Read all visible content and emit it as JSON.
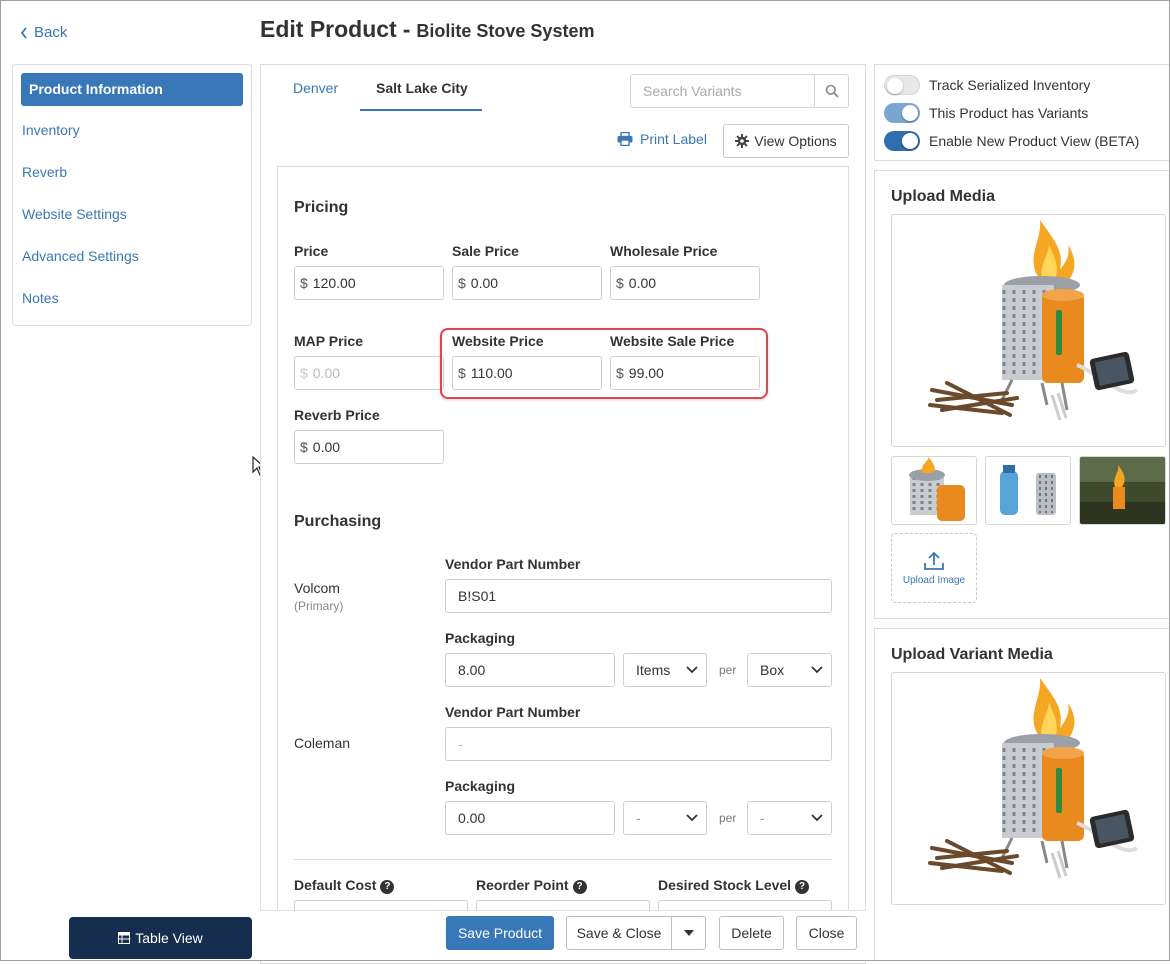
{
  "header": {
    "back_label": "Back",
    "title": "Edit Product",
    "separator": "-",
    "product_name": "Biolite Stove System"
  },
  "sidebar": {
    "items": [
      {
        "label": "Product Information",
        "active": true
      },
      {
        "label": "Inventory"
      },
      {
        "label": "Reverb"
      },
      {
        "label": "Website Settings"
      },
      {
        "label": "Advanced Settings"
      },
      {
        "label": "Notes"
      }
    ],
    "table_view_label": "Table View"
  },
  "tabs": [
    {
      "label": "Denver",
      "active": false
    },
    {
      "label": "Salt Lake City",
      "active": true
    }
  ],
  "search": {
    "placeholder": "Search Variants",
    "value": ""
  },
  "toolbar": {
    "print_label": "Print Label",
    "view_options": "View Options"
  },
  "pricing": {
    "title": "Pricing",
    "currency": "$",
    "price": {
      "label": "Price",
      "value": "120.00"
    },
    "sale_price": {
      "label": "Sale Price",
      "value": "0.00"
    },
    "wholesale_price": {
      "label": "Wholesale Price",
      "value": "0.00"
    },
    "map_price": {
      "label": "MAP Price",
      "value": "0.00"
    },
    "website_price": {
      "label": "Website Price",
      "value": "110.00"
    },
    "website_sale_price": {
      "label": "Website Sale Price",
      "value": "99.00"
    },
    "reverb_price": {
      "label": "Reverb Price",
      "value": "0.00"
    }
  },
  "purchasing": {
    "title": "Purchasing",
    "per_label": "per",
    "vendors": [
      {
        "name": "Volcom",
        "note": "(Primary)",
        "part_number_label": "Vendor Part Number",
        "part_number": "B!S01",
        "packaging_label": "Packaging",
        "packaging_qty": "8.00",
        "unit": "Items",
        "per_unit": "Box"
      },
      {
        "name": "Coleman",
        "part_number_label": "Vendor Part Number",
        "part_number": "-",
        "packaging_label": "Packaging",
        "packaging_qty": "0.00",
        "unit": "-",
        "per_unit": "-"
      }
    ]
  },
  "stock": {
    "default_cost_label": "Default Cost",
    "reorder_point_label": "Reorder Point",
    "desired_stock_label": "Desired Stock Level"
  },
  "footer": {
    "save_product": "Save Product",
    "save_close": "Save & Close",
    "delete": "Delete",
    "close": "Close"
  },
  "settings": {
    "track_serialized": {
      "label": "Track Serialized Inventory",
      "on": false
    },
    "has_variants": {
      "label": "This Product has Variants",
      "on": true
    },
    "new_product_view": {
      "label": "Enable New Product View (BETA)",
      "on": true
    }
  },
  "media": {
    "title": "Upload Media",
    "upload_label": "Upload Image",
    "variant_title": "Upload Variant Media"
  },
  "colors": {
    "accent": "#3878b8",
    "link": "#3a78b5",
    "dark_button": "#162d4f",
    "highlight": "#d9484f",
    "stove_orange": "#e88a1e"
  }
}
